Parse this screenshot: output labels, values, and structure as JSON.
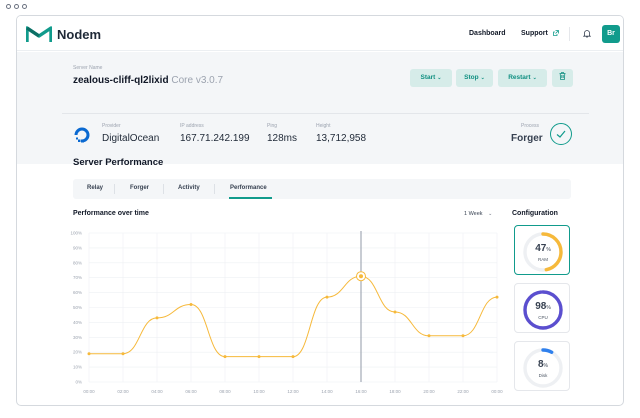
{
  "app": {
    "name": "Nodem"
  },
  "nav": {
    "dashboard": "Dashboard",
    "support": "Support",
    "avatar": "Br"
  },
  "server": {
    "name_label": "Server Name",
    "name": "zealous-cliff-ql2lixid",
    "version": "Core v3.0.7",
    "actions": {
      "start": "Start",
      "stop": "Stop",
      "restart": "Restart"
    }
  },
  "stats": {
    "provider_label": "Provider",
    "provider": "DigitalOcean",
    "ip_label": "IP address",
    "ip": "167.71.242.199",
    "ping_label": "Ping",
    "ping": "128ms",
    "height_label": "Height",
    "height": "13,712,958",
    "process_label": "Process",
    "process": "Forger"
  },
  "performance": {
    "title": "Server Performance",
    "tabs": [
      "Relay",
      "Forger",
      "Activity",
      "Performance"
    ],
    "active_tab": "Performance",
    "chart_title": "Performance over time",
    "range": "1 Week"
  },
  "chart_data": {
    "type": "line",
    "x": [
      "00:00",
      "02:00",
      "04:00",
      "06:00",
      "08:00",
      "10:00",
      "12:00",
      "14:00",
      "16:00",
      "18:00",
      "20:00",
      "22:00",
      "00:00"
    ],
    "values": [
      19,
      19,
      43,
      52,
      17,
      17,
      17,
      57,
      71,
      47,
      31,
      31,
      57
    ],
    "highlight_index": 8,
    "yticks": [
      "0%",
      "10%",
      "20%",
      "30%",
      "40%",
      "50%",
      "60%",
      "70%",
      "80%",
      "90%",
      "100%"
    ],
    "ylim": [
      0,
      100
    ],
    "line_color": "#f6b93b",
    "cursor_color": "#9ca3af"
  },
  "configuration": {
    "title": "Configuration",
    "items": [
      {
        "value": "47",
        "unit": "%",
        "label": "RAM",
        "percent": 47,
        "color": "#f6b93b",
        "active": true
      },
      {
        "value": "98",
        "unit": "%",
        "label": "CPU",
        "percent": 98,
        "color": "#5b4fcf",
        "active": false
      },
      {
        "value": "8",
        "unit": "%",
        "label": "Disk",
        "percent": 8,
        "color": "#2f80ed",
        "active": false
      }
    ]
  },
  "colors": {
    "accent": "#119b8c",
    "accent_soft": "#d6ece9"
  }
}
